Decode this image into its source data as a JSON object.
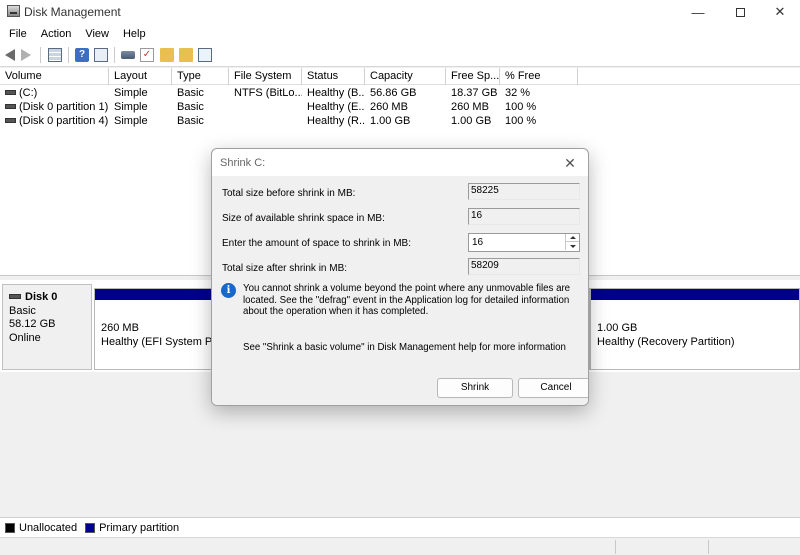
{
  "window": {
    "title": "Disk Management",
    "minimize_glyph": "—",
    "close_glyph": "✕"
  },
  "menu": [
    "File",
    "Action",
    "View",
    "Help"
  ],
  "toolbar": {
    "icons": [
      "back-arrow-icon",
      "forward-arrow-icon",
      "grid-view-icon",
      "help-icon",
      "list-view-icon",
      "disk-icon",
      "check-icon",
      "folder-icon",
      "search-icon",
      "properties-icon"
    ]
  },
  "volumes": {
    "columns": [
      "Volume",
      "Layout",
      "Type",
      "File System",
      "Status",
      "Capacity",
      "Free Sp...",
      "% Free"
    ],
    "rows": [
      {
        "volume": "(C:)",
        "layout": "Simple",
        "type": "Basic",
        "fs": "NTFS (BitLo...",
        "status": "Healthy (B...",
        "capacity": "56.86 GB",
        "free": "18.37 GB",
        "pct": "32 %"
      },
      {
        "volume": "(Disk 0 partition 1)",
        "layout": "Simple",
        "type": "Basic",
        "fs": "",
        "status": "Healthy (E...",
        "capacity": "260 MB",
        "free": "260 MB",
        "pct": "100 %"
      },
      {
        "volume": "(Disk 0 partition 4)",
        "layout": "Simple",
        "type": "Basic",
        "fs": "",
        "status": "Healthy (R...",
        "capacity": "1.00 GB",
        "free": "1.00 GB",
        "pct": "100 %"
      }
    ]
  },
  "disk": {
    "name": "Disk 0",
    "type": "Basic",
    "size": "58.12 GB",
    "state": "Online",
    "partitions": [
      {
        "size": "260 MB",
        "status": "Healthy (EFI System Partition)"
      },
      {
        "size": "1.00 GB",
        "status": "Healthy (Recovery Partition)"
      }
    ]
  },
  "legend": [
    {
      "label": "Unallocated",
      "color": "#000000"
    },
    {
      "label": "Primary partition",
      "color": "#00008b"
    }
  ],
  "dialog": {
    "title": "Shrink C:",
    "close_glyph": "✕",
    "total_before_label": "Total size before shrink in MB:",
    "total_before_value": "58225",
    "available_label": "Size of available shrink space in MB:",
    "available_value": "16",
    "amount_label": "Enter the amount of space to shrink in MB:",
    "amount_value": "16",
    "after_label": "Total size after shrink in MB:",
    "after_value": "58209",
    "info_glyph": "i",
    "info_text": "You cannot shrink a volume beyond the point where any unmovable files are located. See the \"defrag\" event in the Application log for detailed information about the operation when it has completed.",
    "help_text": "See \"Shrink a basic volume\" in Disk Management help for more information",
    "shrink_label": "Shrink",
    "cancel_label": "Cancel"
  }
}
